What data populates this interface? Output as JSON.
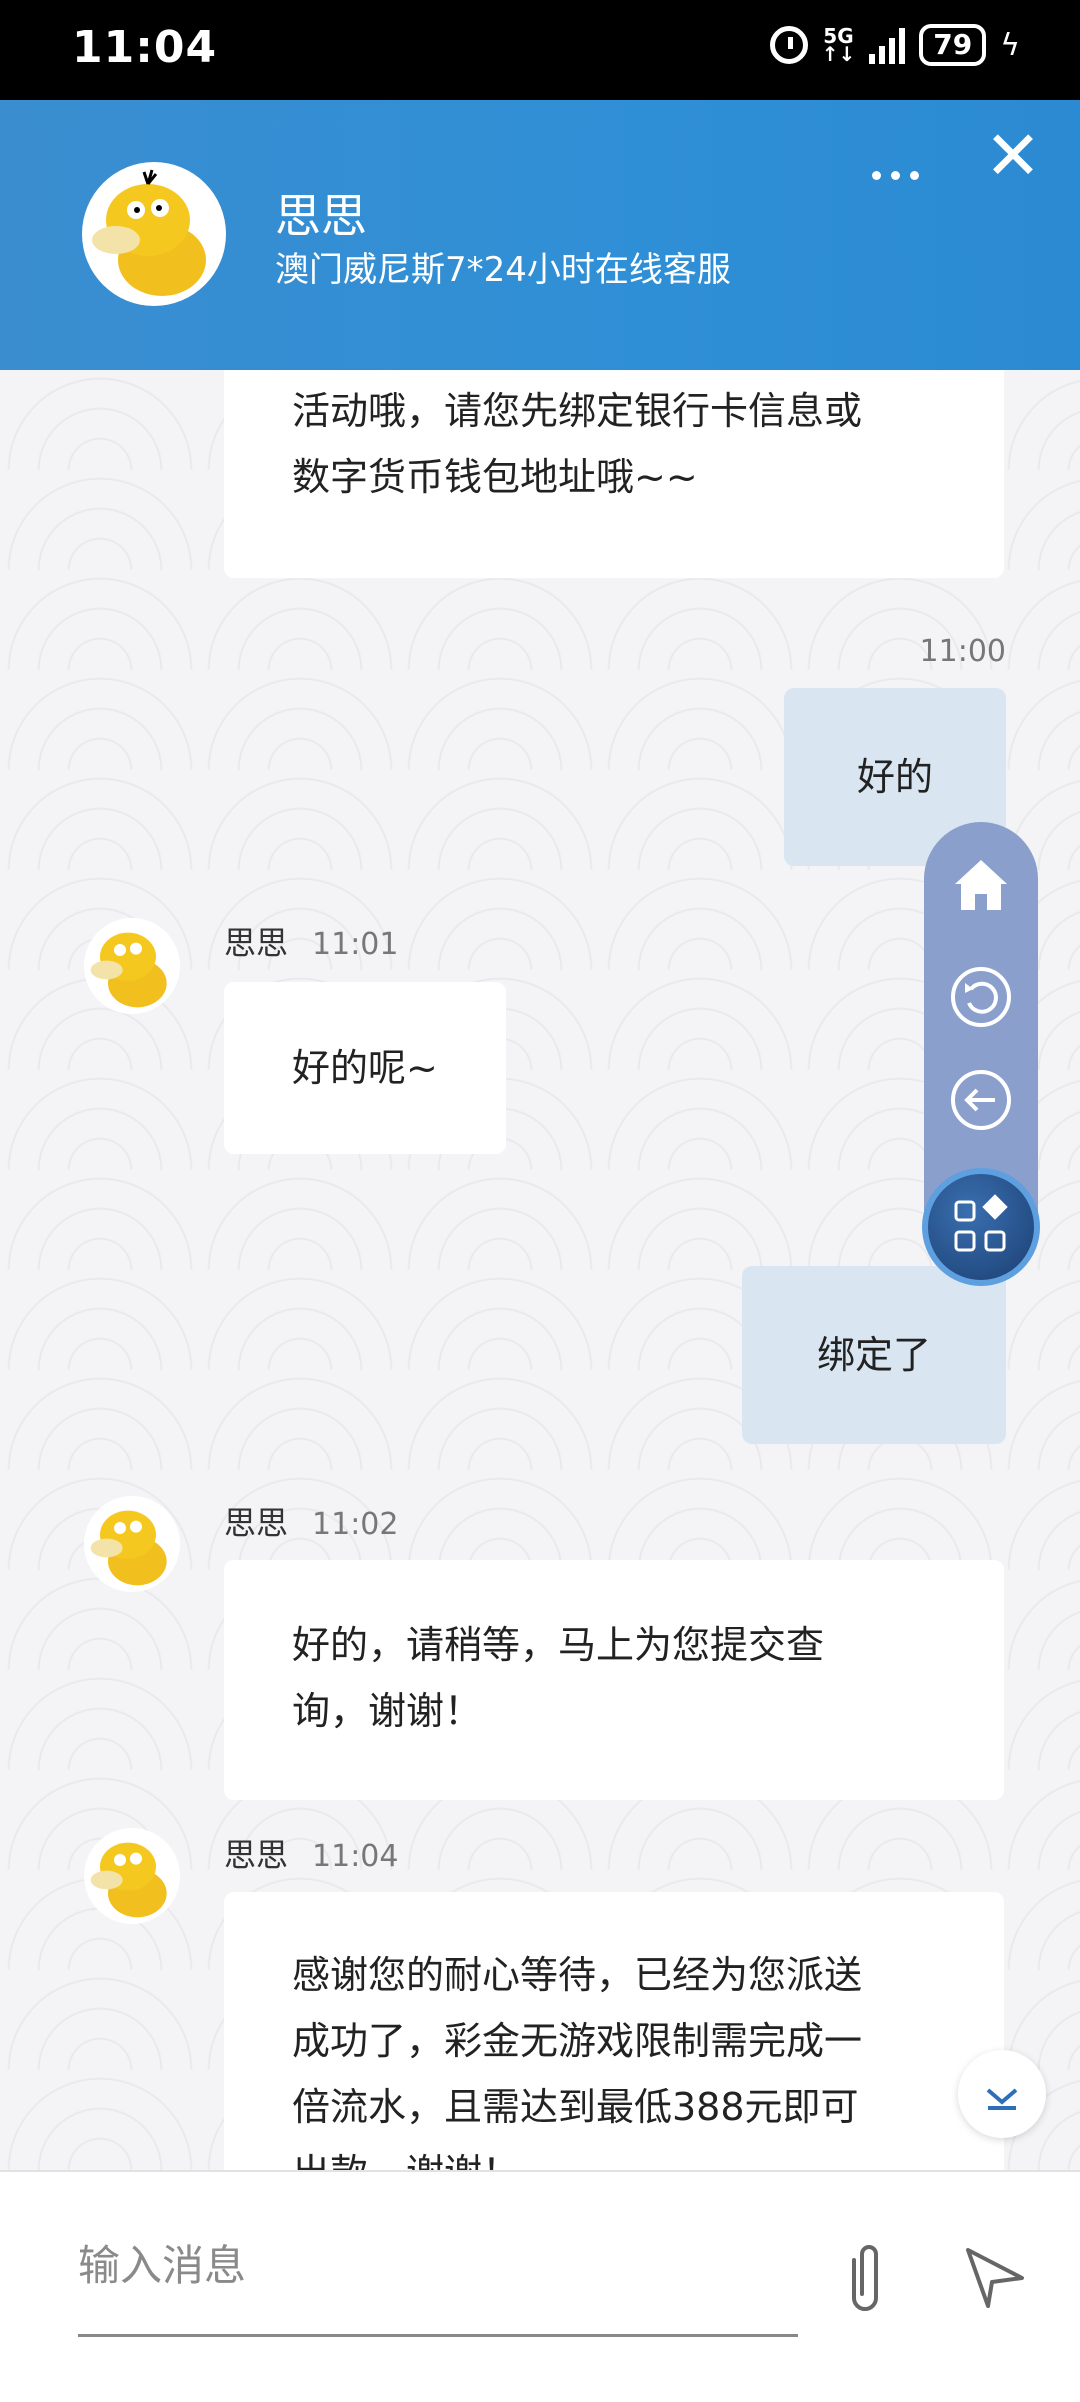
{
  "status_bar": {
    "time": "11:04",
    "network": "5G",
    "battery": "79"
  },
  "header": {
    "name": "思思",
    "subtitle": "澳门威尼斯7*24小时在线客服"
  },
  "messages": {
    "m0": {
      "line1": "活动哦，请您先绑定银行卡信息或",
      "line2": "数字货币钱包地址哦~~"
    },
    "m1": {
      "time": "11:00",
      "text": "好的"
    },
    "m2": {
      "sender": "思思",
      "time": "11:01",
      "text": "好的呢~"
    },
    "m3": {
      "text": "绑定了"
    },
    "m4": {
      "sender": "思思",
      "time": "11:02",
      "line1": "好的，请稍等，马上为您提交查",
      "line2": "询，谢谢！"
    },
    "m5": {
      "sender": "思思",
      "time": "11:04",
      "line1": "感谢您的耐心等待，已经为您派送",
      "line2": "成功了，彩金无游戏限制需完成一",
      "line3": "倍流水，且需达到最低388元即可",
      "line4": "出款，谢谢！"
    }
  },
  "input": {
    "placeholder": "输入消息"
  },
  "colors": {
    "header": "#2f8fd6",
    "my_bubble": "#d9e6f2",
    "float_bar": "#8a9fcc"
  },
  "icons": [
    "alarm-icon",
    "signal-icon",
    "battery-icon",
    "more-icon",
    "close-icon",
    "duck-avatar-icon",
    "home-icon",
    "refresh-icon",
    "back-arrow-icon",
    "apps-icon",
    "chevron-down-icon",
    "paperclip-icon",
    "send-icon"
  ]
}
